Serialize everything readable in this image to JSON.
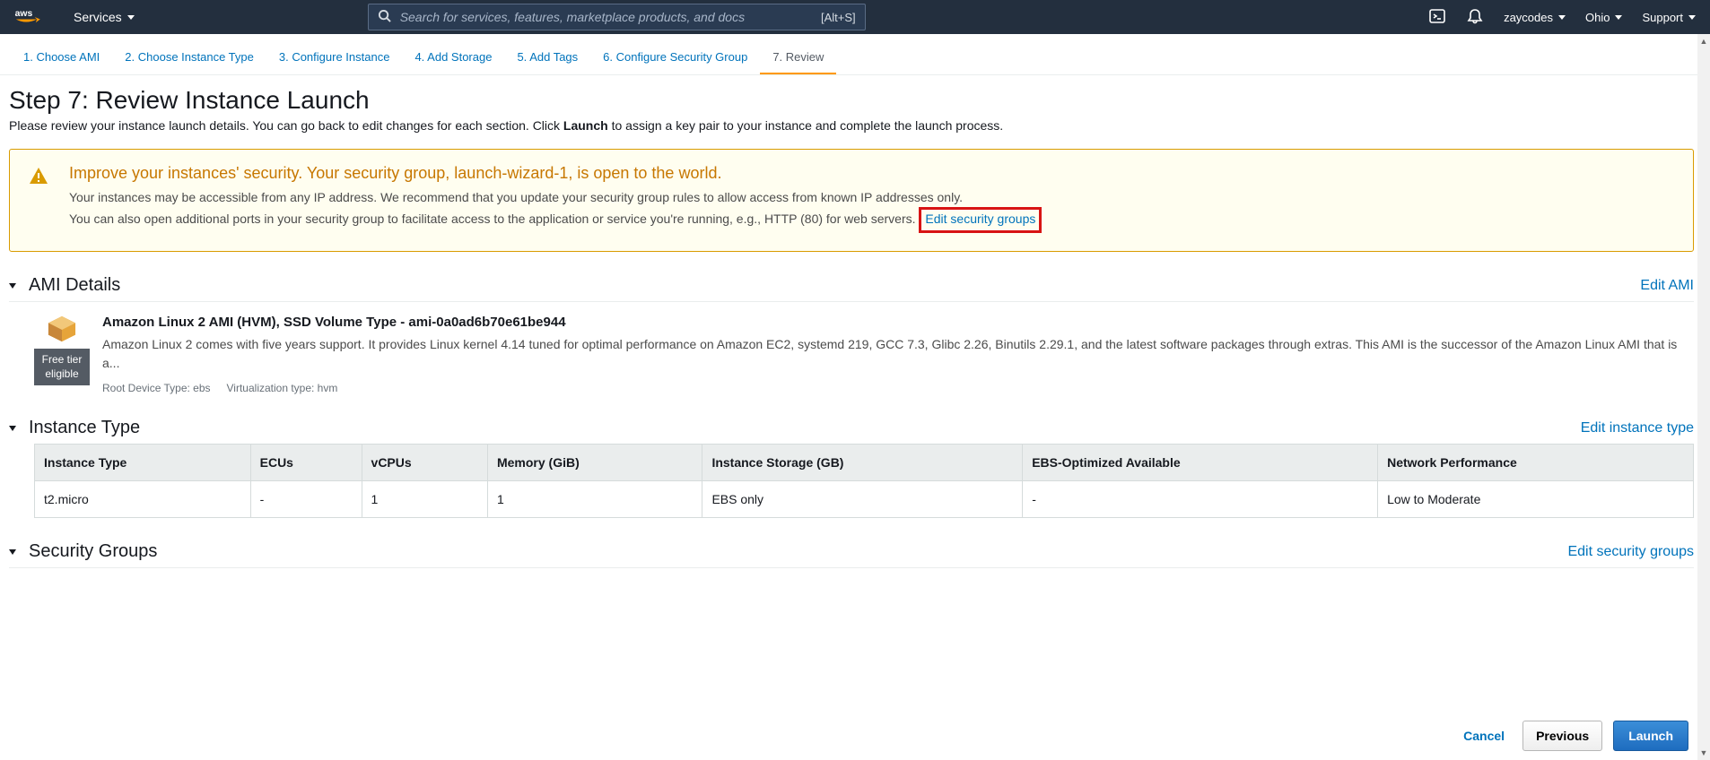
{
  "header": {
    "services_label": "Services",
    "search_placeholder": "Search for services, features, marketplace products, and docs",
    "search_hint": "[Alt+S]",
    "username": "zaycodes",
    "region": "Ohio",
    "support_label": "Support"
  },
  "wizard": {
    "steps": [
      "1. Choose AMI",
      "2. Choose Instance Type",
      "3. Configure Instance",
      "4. Add Storage",
      "5. Add Tags",
      "6. Configure Security Group",
      "7. Review"
    ]
  },
  "page": {
    "title": "Step 7: Review Instance Launch",
    "subtitle_before": "Please review your instance launch details. You can go back to edit changes for each section. Click ",
    "subtitle_bold": "Launch",
    "subtitle_after": " to assign a key pair to your instance and complete the launch process."
  },
  "warning": {
    "title": "Improve your instances' security. Your security group, launch-wizard-1, is open to the world.",
    "line1": "Your instances may be accessible from any IP address. We recommend that you update your security group rules to allow access from known IP addresses only.",
    "line2": "You can also open additional ports in your security group to facilitate access to the application or service you're running, e.g., HTTP (80) for web servers. ",
    "link_text": "Edit security groups"
  },
  "ami": {
    "section_title": "AMI Details",
    "edit_link": "Edit AMI",
    "free_tier_line1": "Free tier",
    "free_tier_line2": "eligible",
    "title": "Amazon Linux 2 AMI (HVM), SSD Volume Type - ami-0a0ad6b70e61be944",
    "description": "Amazon Linux 2 comes with five years support. It provides Linux kernel 4.14 tuned for optimal performance on Amazon EC2, systemd 219, GCC 7.3, Glibc 2.26, Binutils 2.29.1, and the latest software packages through extras. This AMI is the successor of the Amazon Linux AMI that is a...",
    "root_device": "Root Device Type: ebs",
    "virt": "Virtualization type: hvm"
  },
  "instance": {
    "section_title": "Instance Type",
    "edit_link": "Edit instance type",
    "columns": [
      "Instance Type",
      "ECUs",
      "vCPUs",
      "Memory (GiB)",
      "Instance Storage (GB)",
      "EBS-Optimized Available",
      "Network Performance"
    ],
    "row": [
      "t2.micro",
      "-",
      "1",
      "1",
      "EBS only",
      "-",
      "Low to Moderate"
    ]
  },
  "security": {
    "section_title": "Security Groups",
    "edit_link": "Edit security groups"
  },
  "footer": {
    "cancel": "Cancel",
    "previous": "Previous",
    "launch": "Launch"
  }
}
